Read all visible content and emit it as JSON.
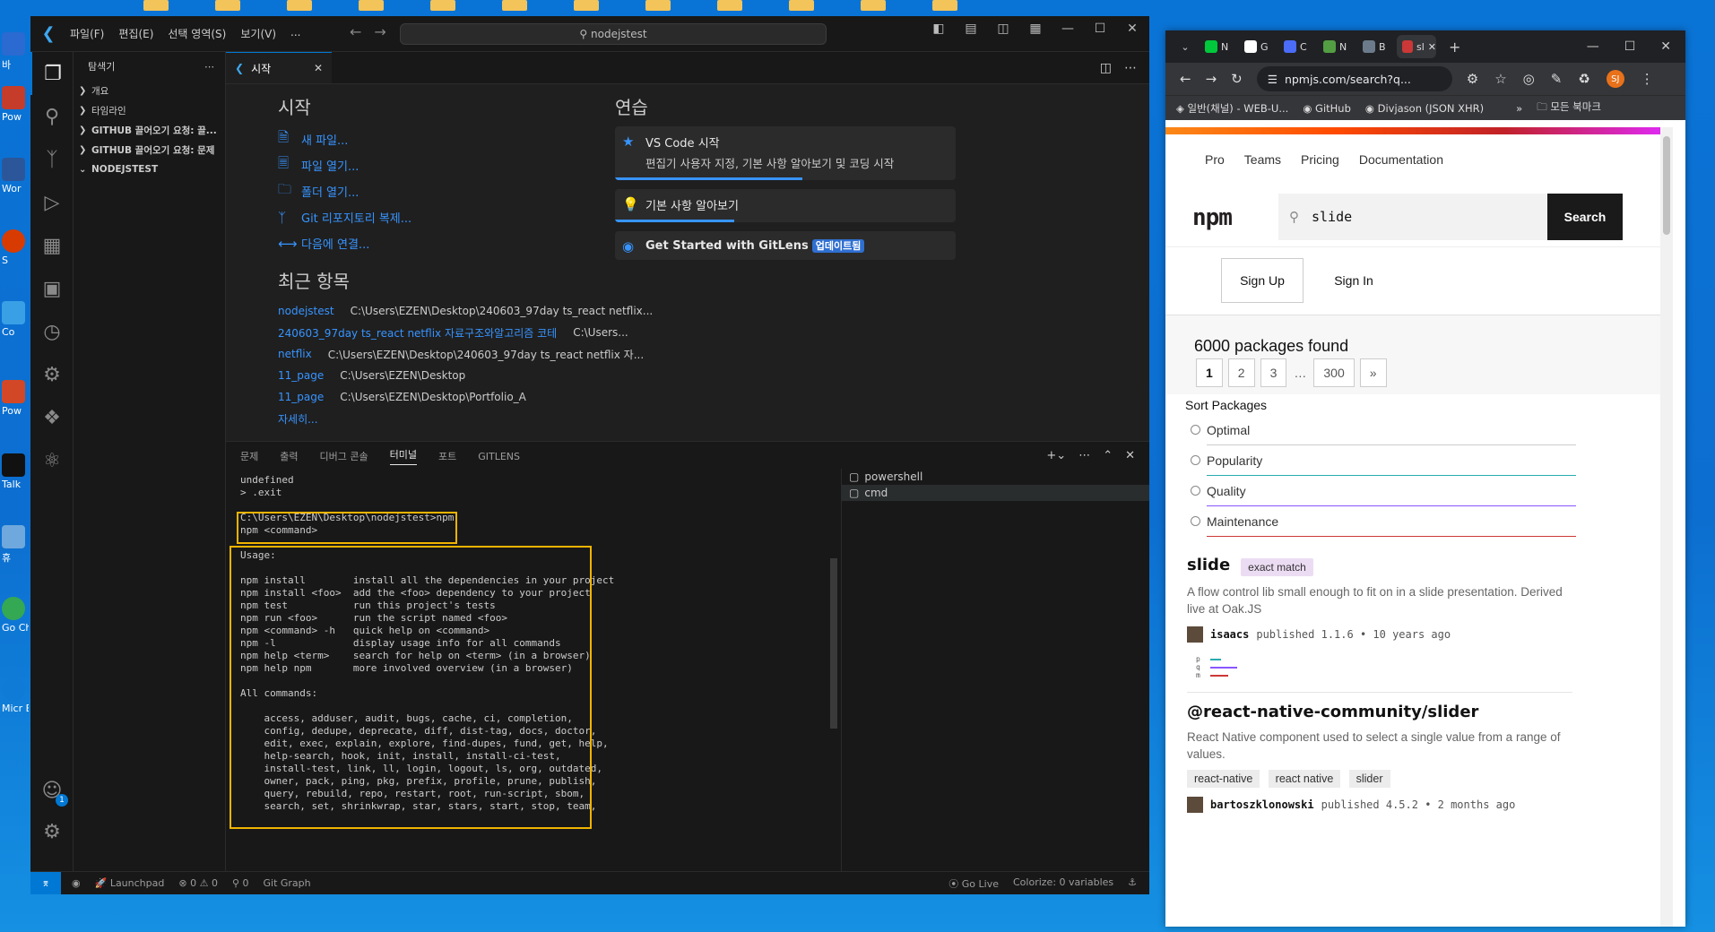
{
  "desktop": {
    "icons": [
      {
        "label": "바",
        "color": "#2a6ad1"
      },
      {
        "label": "Pow",
        "color": "#c53c2b"
      },
      {
        "label": "Wor",
        "color": "#2b579a"
      },
      {
        "label": "S",
        "color": "#d83b01"
      },
      {
        "label": "Co",
        "color": "#3aa0e6"
      },
      {
        "label": "Pow",
        "color": "#d24726"
      },
      {
        "label": "Talk",
        "color": "#111111"
      },
      {
        "label": "휴",
        "color": "#6fa8dc"
      },
      {
        "label": "Go Ch",
        "color": "#34a853"
      },
      {
        "label": "Micr Ed",
        "color": "#0f7bd6"
      }
    ]
  },
  "vscode": {
    "menu": [
      "파일(F)",
      "편집(E)",
      "선택 영역(S)",
      "보기(V)",
      "..."
    ],
    "search_text": "nodejstest",
    "sidebar": {
      "title": "탐색기",
      "items": [
        "개요",
        "타임라인",
        "GITHUB 끌어오기 요청: 끌...",
        "GITHUB 끌어오기 요청: 문제",
        "NODEJSTEST"
      ]
    },
    "tab_label": "시작",
    "welcome": {
      "start_heading": "시작",
      "start_links": [
        "새 파일...",
        "파일 열기...",
        "폴더 열기...",
        "Git 리포지토리 복제...",
        "다음에 연결..."
      ],
      "recent_heading": "최근 항목",
      "recent": [
        {
          "name": "nodejstest",
          "path": "C:\\Users\\EZEN\\Desktop\\240603_97day ts_react netflix..."
        },
        {
          "name": "240603_97day ts_react netflix 자료구조와알고리즘 코테",
          "path": "C:\\Users..."
        },
        {
          "name": "netflix",
          "path": "C:\\Users\\EZEN\\Desktop\\240603_97day ts_react netflix 자..."
        },
        {
          "name": "11_page",
          "path": "C:\\Users\\EZEN\\Desktop"
        },
        {
          "name": "11_page",
          "path": "C:\\Users\\EZEN\\Desktop\\Portfolio_A"
        }
      ],
      "more": "자세히...",
      "practice_heading": "연습",
      "walk1_title": "VS Code 시작",
      "walk1_desc": "편집기 사용자 지정, 기본 사항 알아보기 및 코딩 시작",
      "walk1_progress": 0.55,
      "walk2_title": "기본 사항 알아보기",
      "walk2_progress": 0.35,
      "walk3_title": "Get Started with GitLens",
      "walk3_badge": "업데이트됨"
    },
    "panel_tabs": [
      "문제",
      "출력",
      "디버그 콘솔",
      "터미널",
      "포트",
      "GITLENS"
    ],
    "terminal_lines": [
      "undefined",
      "> .exit",
      "",
      "C:\\Users\\EZEN\\Desktop\\nodejstest>npm",
      "npm <command>",
      "",
      "Usage:",
      "",
      "npm install        install all the dependencies in your project",
      "npm install <foo>  add the <foo> dependency to your project",
      "npm test           run this project's tests",
      "npm run <foo>      run the script named <foo>",
      "npm <command> -h   quick help on <command>",
      "npm -l             display usage info for all commands",
      "npm help <term>    search for help on <term> (in a browser)",
      "npm help npm       more involved overview (in a browser)",
      "",
      "All commands:",
      "",
      "    access, adduser, audit, bugs, cache, ci, completion,",
      "    config, dedupe, deprecate, diff, dist-tag, docs, doctor,",
      "    edit, exec, explain, explore, find-dupes, fund, get, help,",
      "    help-search, hook, init, install, install-ci-test,",
      "    install-test, link, ll, login, logout, ls, org, outdated,",
      "    owner, pack, ping, pkg, prefix, profile, prune, publish,",
      "    query, rebuild, repo, restart, root, run-script, sbom,",
      "    search, set, shrinkwrap, star, stars, start, stop, team,"
    ],
    "terminals": [
      "powershell",
      "cmd"
    ],
    "status": {
      "launchpad": "Launchpad",
      "problems": "0",
      "warnings": "0",
      "ports": "0",
      "git_graph": "Git Graph",
      "go_live": "Go Live",
      "colorize": "Colorize: 0 variables",
      "account_badge": "1"
    }
  },
  "chrome": {
    "url": "npmjs.com/search?q...",
    "avatar": "SJ",
    "tabs": [
      {
        "label": "N",
        "color": "#00c73c"
      },
      {
        "label": "G",
        "color": "#ffffff"
      },
      {
        "label": "C",
        "color": "#4a6cf7"
      },
      {
        "label": "N",
        "color": "#539e43"
      },
      {
        "label": "B",
        "color": "#6b7b8c"
      },
      {
        "label": "sl",
        "color": "#cb3837"
      }
    ],
    "bookmarks": [
      "일반(채널) - WEB-U...",
      "GitHub",
      "Divjason (JSON XHR)"
    ],
    "all_bookmarks": "모든 북마크",
    "npm": {
      "nav": [
        "Pro",
        "Teams",
        "Pricing",
        "Documentation"
      ],
      "search_value": "slide",
      "search_button": "Search",
      "sign_up": "Sign Up",
      "sign_in": "Sign In",
      "found": "6000 packages found",
      "pages": [
        "1",
        "2",
        "3",
        "…",
        "300",
        "»"
      ],
      "sort_heading": "Sort Packages",
      "sort_options": [
        {
          "label": "Optimal",
          "color": "#cccccc"
        },
        {
          "label": "Popularity",
          "color": "#29abb0"
        },
        {
          "label": "Quality",
          "color": "#8956ff"
        },
        {
          "label": "Maintenance",
          "color": "#cb3837"
        }
      ],
      "packages": [
        {
          "name": "slide",
          "badge": "exact match",
          "desc": "A flow control lib small enough to fit on in a slide presentation. Derived live at Oak.JS",
          "user": "isaacs",
          "published": "published 1.1.6 • 10 years ago",
          "score_labels": [
            "p",
            "q",
            "m"
          ]
        },
        {
          "name": "@react-native-community/slider",
          "desc": "React Native component used to select a single value from a range of values.",
          "keywords": [
            "react-native",
            "react native",
            "slider"
          ],
          "user": "bartoszklonowski",
          "published": "published 4.5.2 • 2 months ago"
        }
      ]
    }
  }
}
